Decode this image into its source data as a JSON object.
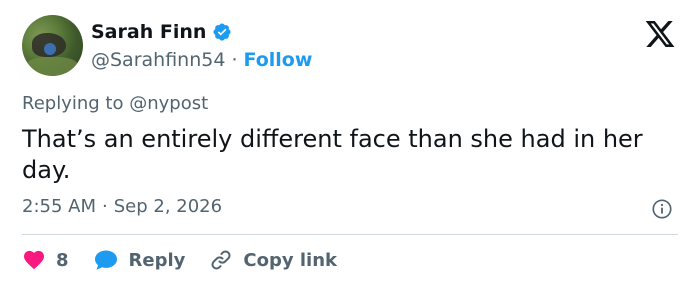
{
  "author": {
    "name": "Sarah Finn",
    "handle": "@Sarahfinn54",
    "separator": "·",
    "follow_label": "Follow",
    "avatar_icon": "user-avatar-photo",
    "verified_icon": "verified-badge-icon",
    "verified_color": "#1d9bf0"
  },
  "platform_icon": "x-logo-icon",
  "reply_context": {
    "prefix": "Replying to",
    "mention": "@nypost"
  },
  "tweet": {
    "text": "That’s an entirely different face than she had in her day.",
    "time": "2:55 AM",
    "separator": "·",
    "date": "Sep 2, 2026"
  },
  "actions": {
    "like_count": "8",
    "like_icon": "heart-icon",
    "like_color": "#f91880",
    "reply_label": "Reply",
    "reply_icon": "reply-bubble-icon",
    "reply_color": "#1d9bf0",
    "copy_label": "Copy link",
    "copy_icon": "link-icon"
  },
  "info_icon": "info-icon"
}
